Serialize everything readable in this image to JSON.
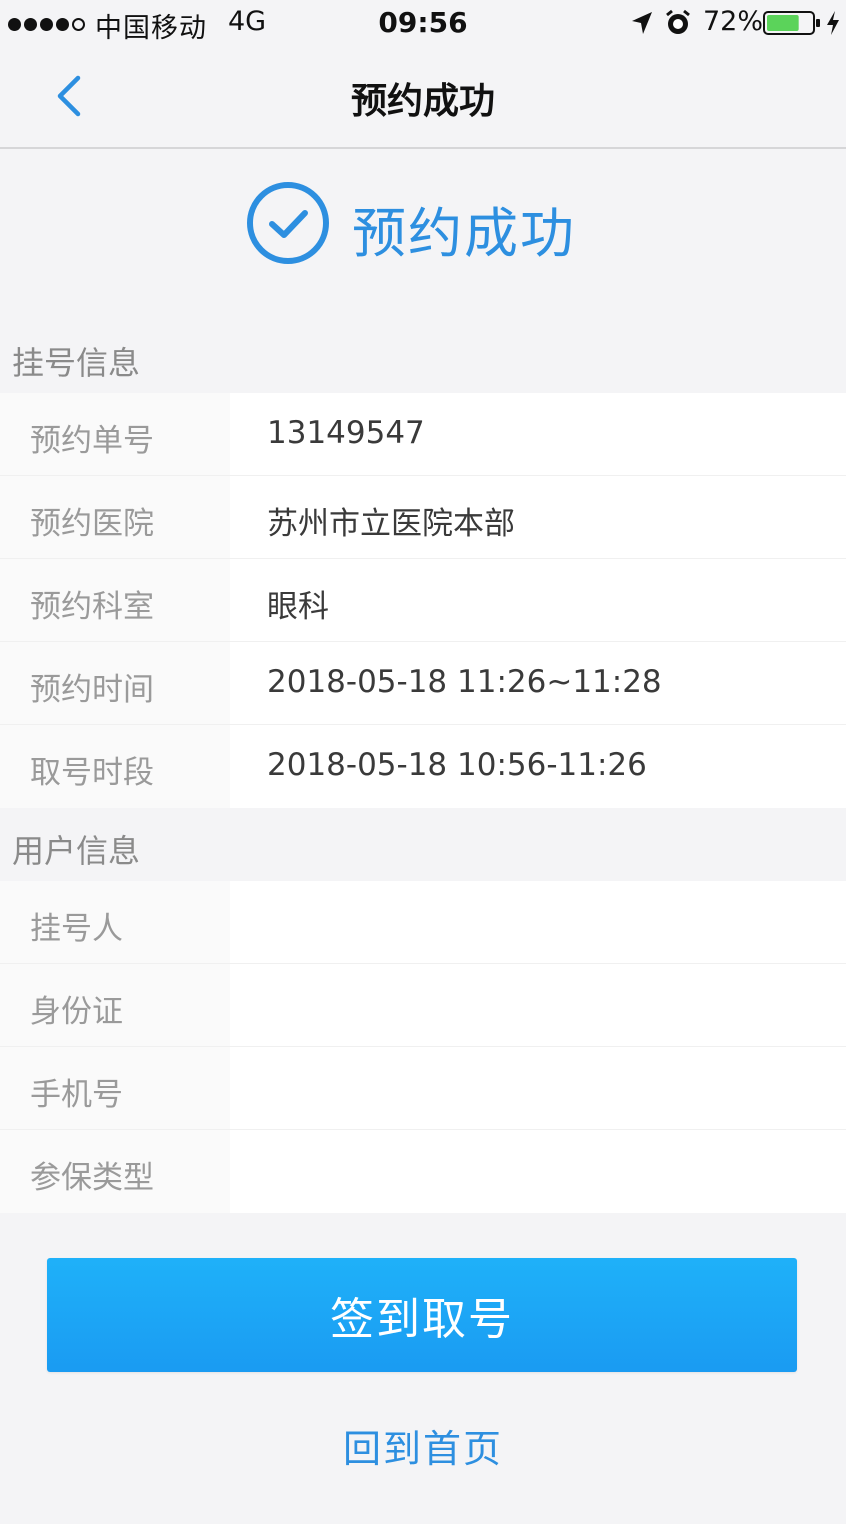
{
  "status_bar": {
    "carrier": "中国移动",
    "network": "4G",
    "time": "09:56",
    "battery": "72%",
    "battery_level": 0.72
  },
  "nav": {
    "title": "预约成功"
  },
  "success": {
    "title": "预约成功",
    "accent_color": "#2d8fe0"
  },
  "registration_info": {
    "header": "挂号信息",
    "rows": [
      {
        "label": "预约单号",
        "value": "13149547"
      },
      {
        "label": "预约医院",
        "value": "苏州市立医院本部"
      },
      {
        "label": "预约科室",
        "value": "眼科"
      },
      {
        "label": "预约时间",
        "value": "2018-05-18 11:26~11:28"
      },
      {
        "label": "取号时段",
        "value": "2018-05-18 10:56-11:26"
      }
    ]
  },
  "user_info": {
    "header": "用户信息",
    "rows": [
      {
        "label": "挂号人",
        "value": ""
      },
      {
        "label": "身份证",
        "value": ""
      },
      {
        "label": "手机号",
        "value": ""
      },
      {
        "label": "参保类型",
        "value": ""
      }
    ]
  },
  "actions": {
    "primary_label": "签到取号",
    "secondary_label": "回到首页",
    "primary_color": "#1ea8f7"
  }
}
